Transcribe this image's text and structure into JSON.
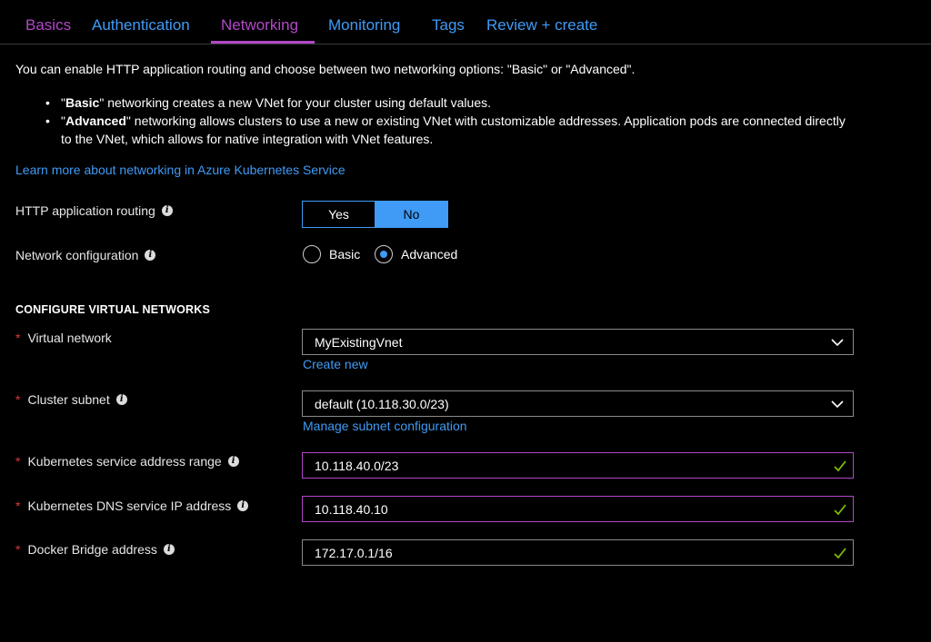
{
  "tabs": [
    {
      "label": "Basics"
    },
    {
      "label": "Authentication"
    },
    {
      "label": "Networking"
    },
    {
      "label": "Monitoring"
    },
    {
      "label": "Tags"
    },
    {
      "label": "Review + create"
    }
  ],
  "active_tab": "Networking",
  "intro_text": "You can enable HTTP application routing and choose between two networking options: \"Basic\" or \"Advanced\".",
  "bullets": [
    {
      "quote_open": "\"",
      "bold": "Basic",
      "quote_close": "\"",
      "text": " networking creates a new VNet for your cluster using default values."
    },
    {
      "quote_open": "\"",
      "bold": "Advanced",
      "quote_close": "\"",
      "text": " networking allows clusters to use a new or existing VNet with customizable addresses. Application pods are connected directly to the VNet, which allows for native integration with VNet features."
    }
  ],
  "learn_more_link": "Learn more about networking in Azure Kubernetes Service",
  "http_routing": {
    "label": "HTTP application routing",
    "options": [
      "Yes",
      "No"
    ],
    "selected": "No"
  },
  "network_config": {
    "label": "Network configuration",
    "options": [
      "Basic",
      "Advanced"
    ],
    "selected": "Advanced"
  },
  "section_title": "CONFIGURE VIRTUAL NETWORKS",
  "fields": {
    "virtual_network": {
      "label": "Virtual network",
      "value": "MyExistingVnet",
      "link": "Create new"
    },
    "cluster_subnet": {
      "label": "Cluster subnet",
      "value": "default (10.118.30.0/23)",
      "link": "Manage subnet configuration"
    },
    "service_range": {
      "label": "Kubernetes service address range",
      "value": "10.118.40.0/23"
    },
    "dns_ip": {
      "label": "Kubernetes DNS service IP address",
      "value": "10.118.40.10"
    },
    "docker_bridge": {
      "label": "Docker Bridge address",
      "value": "172.17.0.1/16"
    }
  },
  "required_marker": "*",
  "info_glyph": "i",
  "colors": {
    "background": "#000000",
    "link_blue": "#3f9bf5",
    "active_purple": "#b147c7",
    "required_red": "#e0383b",
    "valid_green": "#7fba00"
  }
}
